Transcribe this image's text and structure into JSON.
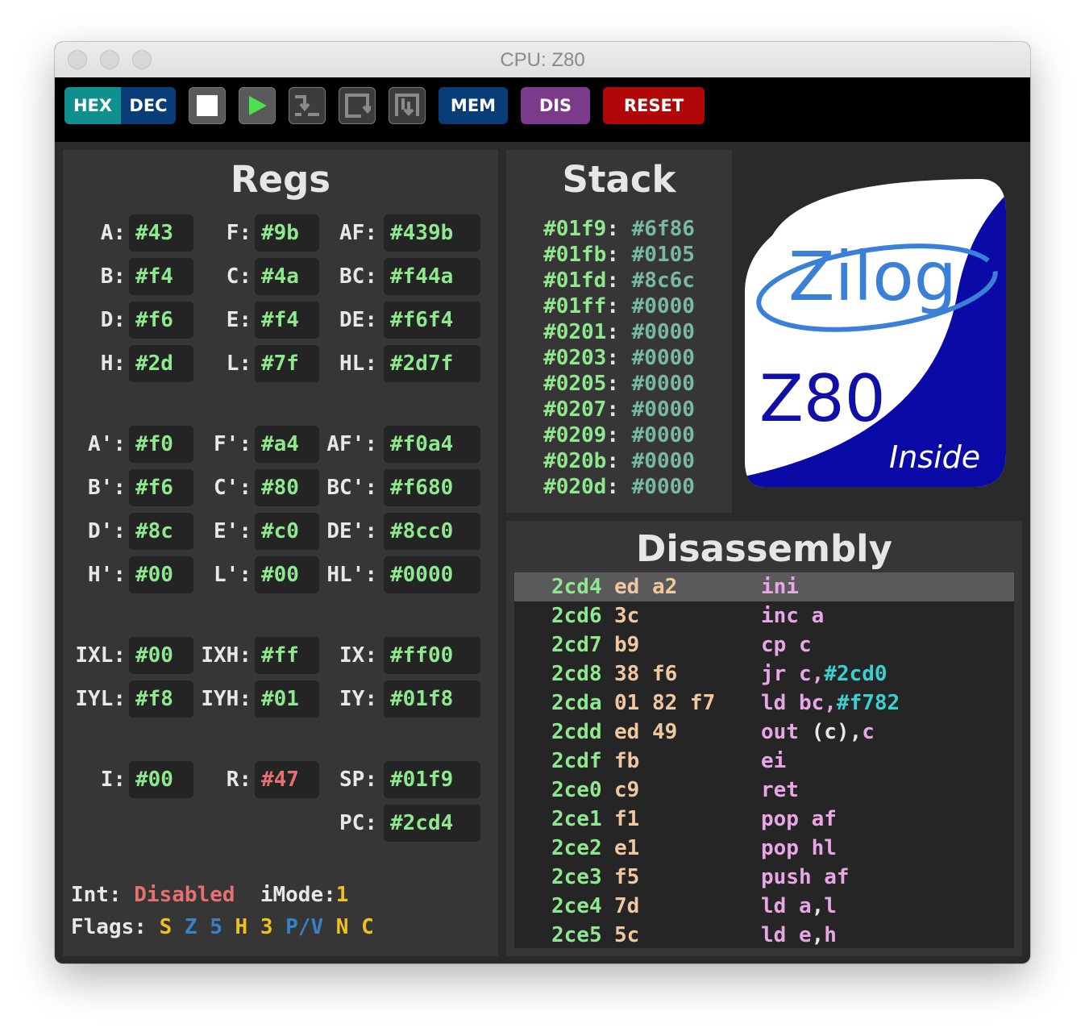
{
  "window": {
    "title": "CPU: Z80"
  },
  "toolbar": {
    "hex": "HEX",
    "dec": "DEC",
    "mem": "MEM",
    "dis": "DIS",
    "reset": "RESET",
    "icons": [
      "stop-icon",
      "play-icon",
      "step-over-icon",
      "step-into-icon",
      "step-out-icon"
    ]
  },
  "regs": {
    "title": "Regs",
    "main": [
      {
        "l": "A:",
        "v": "#43"
      },
      {
        "l": "F:",
        "v": "#9b"
      },
      {
        "l": "AF:",
        "v": "#439b"
      },
      {
        "l": "B:",
        "v": "#f4"
      },
      {
        "l": "C:",
        "v": "#4a"
      },
      {
        "l": "BC:",
        "v": "#f44a"
      },
      {
        "l": "D:",
        "v": "#f6"
      },
      {
        "l": "E:",
        "v": "#f4"
      },
      {
        "l": "DE:",
        "v": "#f6f4"
      },
      {
        "l": "H:",
        "v": "#2d"
      },
      {
        "l": "L:",
        "v": "#7f"
      },
      {
        "l": "HL:",
        "v": "#2d7f"
      }
    ],
    "alt": [
      {
        "l": "A':",
        "v": "#f0"
      },
      {
        "l": "F':",
        "v": "#a4"
      },
      {
        "l": "AF':",
        "v": "#f0a4"
      },
      {
        "l": "B':",
        "v": "#f6"
      },
      {
        "l": "C':",
        "v": "#80"
      },
      {
        "l": "BC':",
        "v": "#f680"
      },
      {
        "l": "D':",
        "v": "#8c"
      },
      {
        "l": "E':",
        "v": "#c0"
      },
      {
        "l": "DE':",
        "v": "#8cc0"
      },
      {
        "l": "H':",
        "v": "#00"
      },
      {
        "l": "L':",
        "v": "#00"
      },
      {
        "l": "HL':",
        "v": "#0000"
      }
    ],
    "index": [
      {
        "l": "IXL:",
        "v": "#00"
      },
      {
        "l": "IXH:",
        "v": "#ff"
      },
      {
        "l": "IX:",
        "v": "#ff00"
      },
      {
        "l": "IYL:",
        "v": "#f8"
      },
      {
        "l": "IYH:",
        "v": "#01"
      },
      {
        "l": "IY:",
        "v": "#01f8"
      }
    ],
    "special": [
      {
        "l": "I:",
        "v": "#00"
      },
      {
        "l": "R:",
        "v": "#47"
      },
      {
        "l": "SP:",
        "v": "#01f9"
      },
      {
        "l": "PC:",
        "v": "#2cd4"
      }
    ],
    "int_label": "Int:",
    "int_value": "Disabled",
    "imode_label": "iMode:",
    "imode_value": "1",
    "flags_label": "Flags:",
    "flags": [
      "S",
      "Z",
      "5",
      "H",
      "3",
      "P/V",
      "N",
      "C"
    ],
    "colors": {
      "value": "#8ee88e",
      "changed": "#e87070",
      "flag_set": "#f0c020",
      "flag_clear": "#3a80c8"
    }
  },
  "stack": {
    "title": "Stack",
    "entries": [
      {
        "a": "#01f9",
        "v": "#6f86"
      },
      {
        "a": "#01fb",
        "v": "#0105"
      },
      {
        "a": "#01fd",
        "v": "#8c6c"
      },
      {
        "a": "#01ff",
        "v": "#0000"
      },
      {
        "a": "#0201",
        "v": "#0000"
      },
      {
        "a": "#0203",
        "v": "#0000"
      },
      {
        "a": "#0205",
        "v": "#0000"
      },
      {
        "a": "#0207",
        "v": "#0000"
      },
      {
        "a": "#0209",
        "v": "#0000"
      },
      {
        "a": "#020b",
        "v": "#0000"
      },
      {
        "a": "#020d",
        "v": "#0000"
      }
    ]
  },
  "logo": {
    "brand": "Zilog",
    "model": "Z80",
    "tagline": "Inside"
  },
  "disasm": {
    "title": "Disassembly",
    "rows": [
      {
        "addr": "2cd4",
        "bytes": "ed a2",
        "op": "ini",
        "arg": "",
        "num": "",
        "current": true
      },
      {
        "addr": "2cd6",
        "bytes": "3c",
        "op": "inc a",
        "arg": "",
        "num": ""
      },
      {
        "addr": "2cd7",
        "bytes": "b9",
        "op": "cp c",
        "arg": "",
        "num": ""
      },
      {
        "addr": "2cd8",
        "bytes": "38 f6",
        "op": "jr c,",
        "arg": "",
        "num": "#2cd0"
      },
      {
        "addr": "2cda",
        "bytes": "01 82 f7",
        "op": "ld bc,",
        "arg": "",
        "num": "#f782"
      },
      {
        "addr": "2cdd",
        "bytes": "ed 49",
        "op": "out ",
        "arg": "(c),",
        "num": "",
        "tail": "c"
      },
      {
        "addr": "2cdf",
        "bytes": "fb",
        "op": "ei",
        "arg": "",
        "num": ""
      },
      {
        "addr": "2ce0",
        "bytes": "c9",
        "op": "ret",
        "arg": "",
        "num": ""
      },
      {
        "addr": "2ce1",
        "bytes": "f1",
        "op": "pop af",
        "arg": "",
        "num": ""
      },
      {
        "addr": "2ce2",
        "bytes": "e1",
        "op": "pop hl",
        "arg": "",
        "num": ""
      },
      {
        "addr": "2ce3",
        "bytes": "f5",
        "op": "push af",
        "arg": "",
        "num": ""
      },
      {
        "addr": "2ce4",
        "bytes": "7d",
        "op": "ld a",
        "arg": ",",
        "num": "",
        "tail": "l"
      },
      {
        "addr": "2ce5",
        "bytes": "5c",
        "op": "ld e",
        "arg": ",",
        "num": "",
        "tail": "h"
      }
    ]
  }
}
